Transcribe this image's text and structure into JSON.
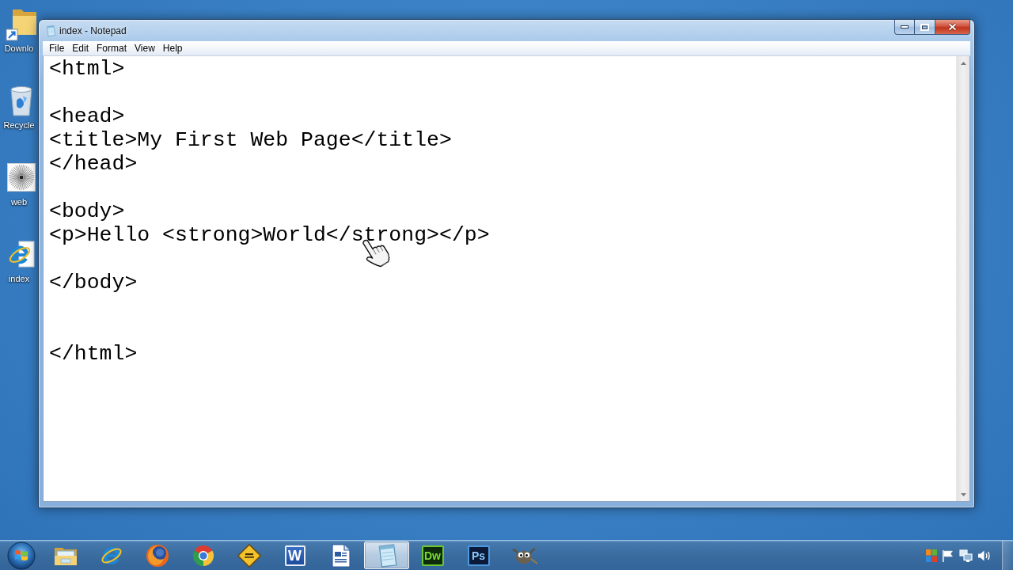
{
  "desktop_icons": [
    {
      "kind": "foldershortcut",
      "label": "Downlo"
    },
    {
      "kind": "recyclebin",
      "label": "Recycle"
    },
    {
      "kind": "image",
      "label": "web"
    },
    {
      "kind": "webfile",
      "label": "index"
    }
  ],
  "window": {
    "title": "index - Notepad",
    "menu": [
      "File",
      "Edit",
      "Format",
      "View",
      "Help"
    ],
    "text": "<html>\n\n<head>\n<title>My First Web Page</title>\n</head>\n\n<body>\n<p>Hello <strong>World</strong></p>\n\n</body>\n\n\n</html>"
  },
  "taskbar": {
    "items": [
      {
        "kind": "folder",
        "selected": false
      },
      {
        "kind": "ebrowser",
        "selected": false
      },
      {
        "kind": "foxbrowser",
        "selected": false
      },
      {
        "kind": "wheelbrowser",
        "selected": false
      },
      {
        "kind": "diamond",
        "selected": false
      },
      {
        "kind": "wordtile",
        "logo_text": "W",
        "selected": false
      },
      {
        "kind": "document",
        "selected": false
      },
      {
        "kind": "notepad",
        "selected": true
      },
      {
        "kind": "dwtile",
        "logo_text": "Dw",
        "selected": false
      },
      {
        "kind": "pstile",
        "logo_text": "Ps",
        "selected": false
      },
      {
        "kind": "mascot",
        "selected": false
      }
    ]
  }
}
